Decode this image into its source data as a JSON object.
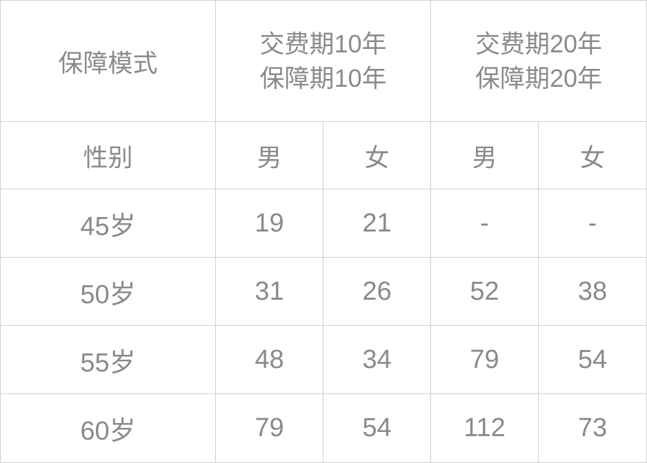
{
  "header": {
    "mode_label": "保障模式",
    "plan_10": {
      "line1": "交费期10年",
      "line2": "保障期10年"
    },
    "plan_20": {
      "line1": "交费期20年",
      "line2": "保障期20年"
    }
  },
  "sex_row": {
    "label": "性别",
    "plan10_male": "男",
    "plan10_female": "女",
    "plan20_male": "男",
    "plan20_female": "女"
  },
  "rows": [
    {
      "age": "45岁",
      "p10_m": "19",
      "p10_f": "21",
      "p20_m": "-",
      "p20_f": "-"
    },
    {
      "age": "50岁",
      "p10_m": "31",
      "p10_f": "26",
      "p20_m": "52",
      "p20_f": "38"
    },
    {
      "age": "55岁",
      "p10_m": "48",
      "p10_f": "34",
      "p20_m": "79",
      "p20_f": "54"
    },
    {
      "age": "60岁",
      "p10_m": "79",
      "p10_f": "54",
      "p20_m": "112",
      "p20_f": "73"
    }
  ]
}
